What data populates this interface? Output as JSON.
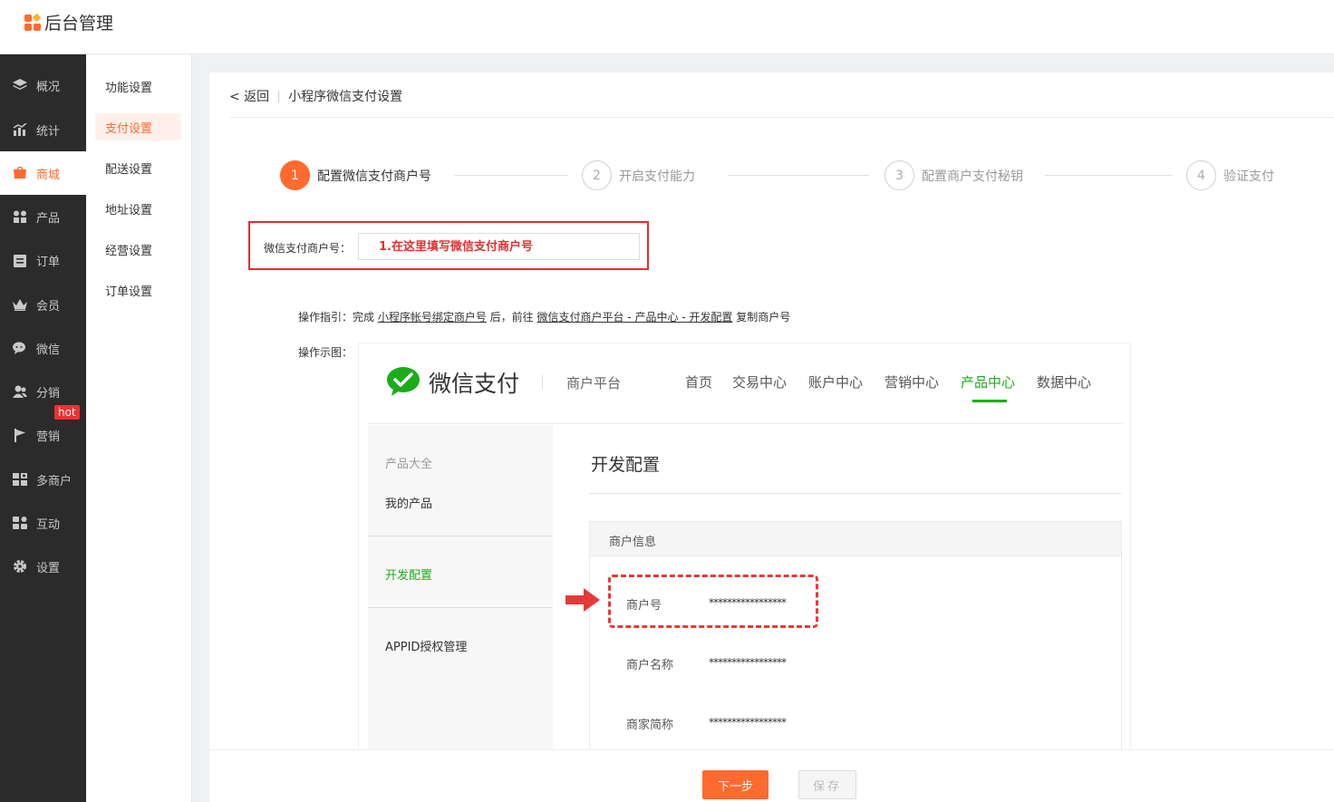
{
  "app": {
    "title": "后台管理"
  },
  "sidebar": {
    "items": [
      {
        "label": "概况",
        "icon": "layers-icon"
      },
      {
        "label": "统计",
        "icon": "chart-icon"
      },
      {
        "label": "商城",
        "icon": "shop-icon",
        "active": true
      },
      {
        "label": "产品",
        "icon": "grid-icon"
      },
      {
        "label": "订单",
        "icon": "order-icon"
      },
      {
        "label": "会员",
        "icon": "crown-icon"
      },
      {
        "label": "微信",
        "icon": "wechat-icon"
      },
      {
        "label": "分销",
        "icon": "users-icon"
      },
      {
        "label": "营销",
        "icon": "flag-icon",
        "badge": "hot"
      },
      {
        "label": "多商户",
        "icon": "store-icon"
      },
      {
        "label": "互动",
        "icon": "apps-icon"
      },
      {
        "label": "设置",
        "icon": "gear-icon"
      }
    ]
  },
  "subnav": {
    "items": [
      {
        "label": "功能设置"
      },
      {
        "label": "支付设置",
        "active": true
      },
      {
        "label": "配送设置"
      },
      {
        "label": "地址设置"
      },
      {
        "label": "经营设置"
      },
      {
        "label": "订单设置"
      }
    ]
  },
  "breadcrumb": {
    "back": "< 返回",
    "title": "小程序微信支付设置"
  },
  "steps": [
    {
      "num": "1",
      "label": "配置微信支付商户号",
      "active": true
    },
    {
      "num": "2",
      "label": "开启支付能力"
    },
    {
      "num": "3",
      "label": "配置商户支付秘钥"
    },
    {
      "num": "4",
      "label": "验证支付"
    }
  ],
  "form": {
    "merchant_label": "微信支付商户号：",
    "merchant_placeholder": "1.在这里填写微信支付商户号"
  },
  "guide": {
    "prefix": "操作指引：完成 ",
    "link1": "小程序帐号绑定商户号",
    "middle": " 后，前往 ",
    "link2": "微信支付商户平台 - 产品中心 - 开发配置",
    "suffix": " 复制商户号"
  },
  "demo_label": "操作示图：",
  "demo": {
    "brand": "微信支付",
    "platform": "商户平台",
    "nav": [
      "首页",
      "交易中心",
      "账户中心",
      "营销中心",
      "产品中心",
      "数据中心"
    ],
    "nav_active_index": 4,
    "left_menu": [
      "产品大全",
      "我的产品",
      "开发配置",
      "APPID授权管理"
    ],
    "section_title": "开发配置",
    "info_header": "商户信息",
    "rows": [
      {
        "label": "商户号",
        "value": "*****************"
      },
      {
        "label": "商户名称",
        "value": "*****************"
      },
      {
        "label": "商家简称",
        "value": "*****************"
      }
    ]
  },
  "footer": {
    "next_label": "下一步",
    "save_label": "保存"
  },
  "colors": {
    "accent": "#ff6a2f",
    "wechat_green": "#1aad19",
    "alert_red": "#e23030"
  }
}
